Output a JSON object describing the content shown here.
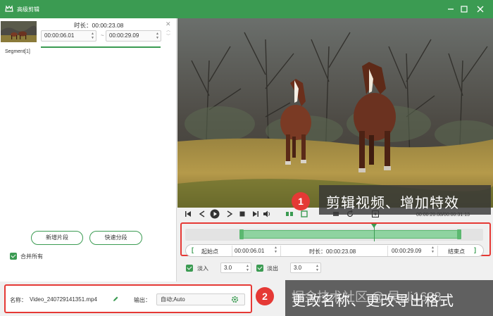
{
  "window": {
    "title": "高级剪辑",
    "accent": "#3b9b52",
    "highlight": "#e53935"
  },
  "segment": {
    "duration_label": "时长：00:00:23.08",
    "start_time": "00:00:06.01",
    "separator": "~",
    "end_time": "00:00:29.09",
    "label": "Segment[1]"
  },
  "left_actions": {
    "new_segment": "新增片段",
    "quick_split": "快速分段",
    "merge_all": "合并所有",
    "merge_all_checked": true
  },
  "player": {
    "time_readout": "00:00:20.08/00:00:31.13",
    "icons": [
      "mark-in-icon",
      "prev-frame-icon",
      "play-icon",
      "next-frame-icon",
      "stop-icon",
      "mark-out-icon",
      "volume-icon",
      "split-icon",
      "crop-icon",
      "zoom-in-icon",
      "rotate-icon",
      "snapshot-icon"
    ]
  },
  "annotation_1": {
    "badge": "1",
    "text": "剪辑视频、增加特效"
  },
  "annotation_2": {
    "badge": "2",
    "text": "更改名称、更改导出格式",
    "watermark": "掘金技术社区 @ 吴ali1638"
  },
  "timeline": {
    "selection_start_fraction": 0.193,
    "selection_end_fraction": 0.934,
    "playhead_fraction": 0.645
  },
  "range": {
    "start_bracket": "[",
    "start_label": "起始点",
    "start_value": "00:00:06.01",
    "duration_label": "时长：00:00:23.08",
    "end_value": "00:00:29.09",
    "end_label": "结束点",
    "end_bracket": "]"
  },
  "fade": {
    "fade_in_label": "淡入",
    "fade_in_value": "3.0",
    "fade_in_checked": true,
    "fade_out_label": "淡出",
    "fade_out_value": "3.0",
    "fade_out_checked": true
  },
  "output": {
    "name_label": "名称：",
    "filename": "Video_240729141351.mp4",
    "format_label": "输出：",
    "format_value": "自动;Auto"
  }
}
